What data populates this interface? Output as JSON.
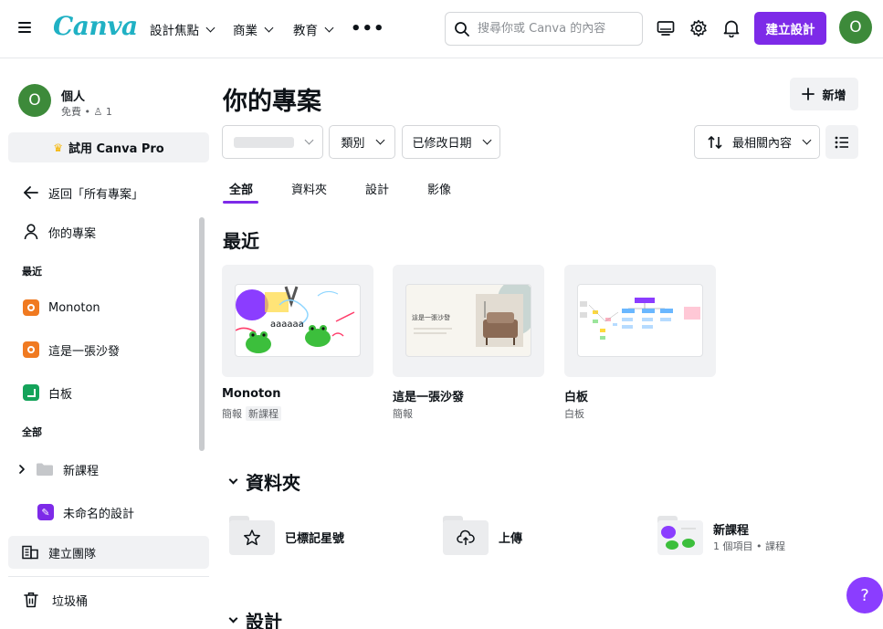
{
  "header": {
    "logo": "Canva",
    "nav": [
      {
        "label": "設計焦點"
      },
      {
        "label": "商業"
      },
      {
        "label": "教育"
      }
    ],
    "more": "•••",
    "search_placeholder": "搜尋你或 Canva 的內容",
    "create_label": "建立設計",
    "avatar_initial": "O"
  },
  "sidebar": {
    "user": {
      "initial": "O",
      "name": "個人",
      "plan": "免費 • ♙ 1"
    },
    "try_pro": "試用 Canva Pro",
    "back": "返回「所有專案」",
    "your_projects": "你的專案",
    "recent_heading": "最近",
    "recent": [
      {
        "label": "Monoton",
        "icon": "presentation-icon"
      },
      {
        "label": "這是一張沙發",
        "icon": "presentation-icon"
      },
      {
        "label": "白板",
        "icon": "whiteboard-icon"
      }
    ],
    "all_heading": "全部",
    "all": [
      {
        "label": "新課程",
        "icon": "folder-icon"
      },
      {
        "label": "未命名的設計",
        "icon": "design-icon"
      }
    ],
    "create_team": "建立團隊",
    "trash": "垃圾桶"
  },
  "main": {
    "title": "你的專案",
    "new_label": "新增",
    "filters": {
      "category": "類別",
      "modified": "已修改日期",
      "sort": "最相關內容"
    },
    "tabs": [
      {
        "label": "全部"
      },
      {
        "label": "資料夾"
      },
      {
        "label": "設計"
      },
      {
        "label": "影像"
      }
    ],
    "recent_title": "最近",
    "recent_cards": [
      {
        "title": "Monoton",
        "type": "簡報",
        "tag": "新課程"
      },
      {
        "title": "這是一張沙發",
        "type": "簡報",
        "tag": ""
      },
      {
        "title": "白板",
        "type": "白板",
        "tag": ""
      }
    ],
    "thumb_text": {
      "monoton": "aaaaaa",
      "sofa": "這是一張沙發"
    },
    "folders_title": "資料夾",
    "folders": [
      {
        "label": "已標記星號",
        "sub": ""
      },
      {
        "label": "上傳",
        "sub": ""
      },
      {
        "label": "新課程",
        "sub": "1 個項目 • 課程"
      }
    ],
    "designs_title": "設計"
  },
  "help_label": "?",
  "colors": {
    "accent": "#7d2ae8",
    "logo": "#20b1c4",
    "avatar": "#3d8a3a"
  }
}
